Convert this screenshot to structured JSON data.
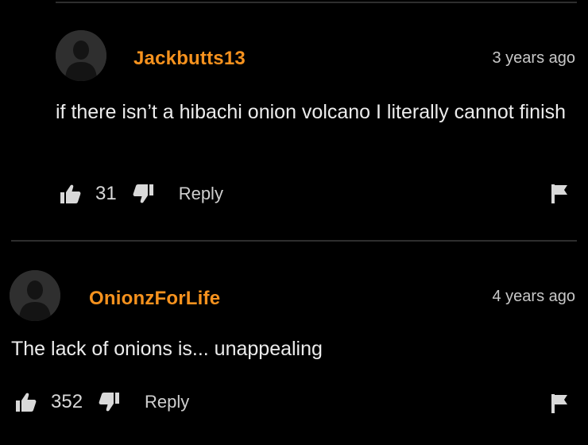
{
  "colors": {
    "background": "#000000",
    "username": "#f6921e",
    "text": "#ececec",
    "muted": "#c8c8c8",
    "divider": "#2e2e2e"
  },
  "comments": [
    {
      "username": "Jackbutts13",
      "timestamp": "3 years ago",
      "text": "if there isn’t a hibachi onion volcano I literally cannot finish",
      "likes": "31",
      "reply_label": "Reply",
      "icons": {
        "avatar": "default-user-avatar",
        "like": "thumbs-up-icon",
        "dislike": "thumbs-down-icon",
        "flag": "flag-icon"
      }
    },
    {
      "username": "OnionzForLife",
      "timestamp": "4 years ago",
      "text": "The lack of onions is... unappealing",
      "likes": "352",
      "reply_label": "Reply",
      "icons": {
        "avatar": "default-user-avatar",
        "like": "thumbs-up-icon",
        "dislike": "thumbs-down-icon",
        "flag": "flag-icon"
      }
    }
  ]
}
